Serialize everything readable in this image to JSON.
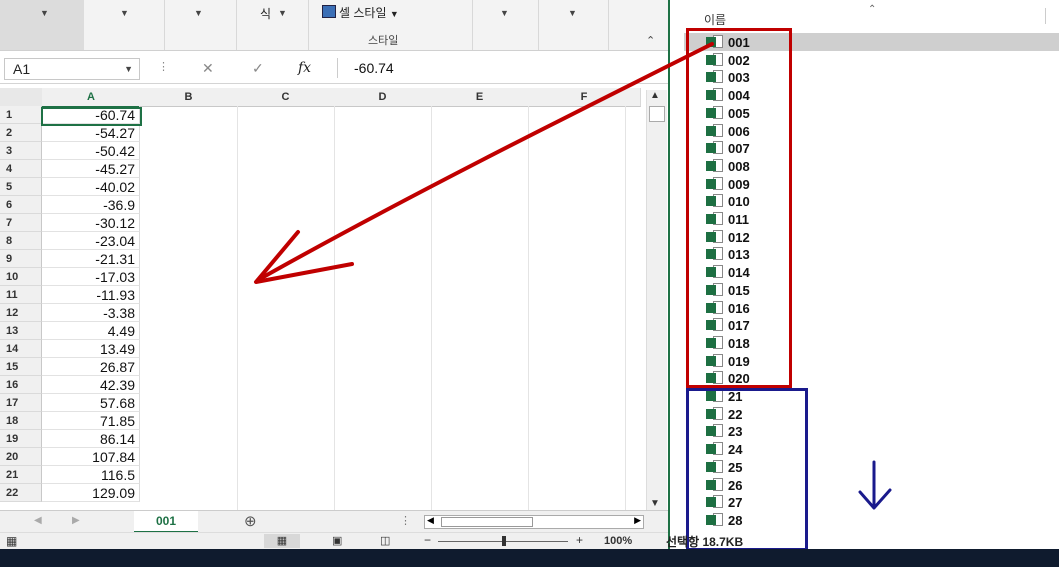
{
  "ribbon": {
    "group_label_1": "식",
    "cell_styles_button": "셀 스타일",
    "styles_group_label": "스타일"
  },
  "formula_bar": {
    "name_box": "A1",
    "fx_label": "fx",
    "value": "-60.74"
  },
  "columns": [
    "A",
    "B",
    "C",
    "D",
    "E",
    "F"
  ],
  "rows": [
    {
      "n": "1",
      "a": "-60.74"
    },
    {
      "n": "2",
      "a": "-54.27"
    },
    {
      "n": "3",
      "a": "-50.42"
    },
    {
      "n": "4",
      "a": "-45.27"
    },
    {
      "n": "5",
      "a": "-40.02"
    },
    {
      "n": "6",
      "a": "-36.9"
    },
    {
      "n": "7",
      "a": "-30.12"
    },
    {
      "n": "8",
      "a": "-23.04"
    },
    {
      "n": "9",
      "a": "-21.31"
    },
    {
      "n": "10",
      "a": "-17.03"
    },
    {
      "n": "11",
      "a": "-11.93"
    },
    {
      "n": "12",
      "a": "-3.38"
    },
    {
      "n": "13",
      "a": "4.49"
    },
    {
      "n": "14",
      "a": "13.49"
    },
    {
      "n": "15",
      "a": "26.87"
    },
    {
      "n": "16",
      "a": "42.39"
    },
    {
      "n": "17",
      "a": "57.68"
    },
    {
      "n": "18",
      "a": "71.85"
    },
    {
      "n": "19",
      "a": "86.14"
    },
    {
      "n": "20",
      "a": "107.84"
    },
    {
      "n": "21",
      "a": "116.5"
    },
    {
      "n": "22",
      "a": "129.09"
    }
  ],
  "sheet_tab": "001",
  "zoom": "100%",
  "explorer": {
    "column_header": "이름",
    "files": [
      "001",
      "002",
      "003",
      "004",
      "005",
      "006",
      "007",
      "008",
      "009",
      "010",
      "011",
      "012",
      "013",
      "014",
      "015",
      "016",
      "017",
      "018",
      "019",
      "020",
      "21",
      "22",
      "23",
      "24",
      "25",
      "26",
      "27",
      "28"
    ],
    "status": "선택항 18.7KB"
  },
  "colors": {
    "excel_green": "#1e7145",
    "red_annotation": "#c00000",
    "blue_annotation": "#1a1a8c"
  }
}
